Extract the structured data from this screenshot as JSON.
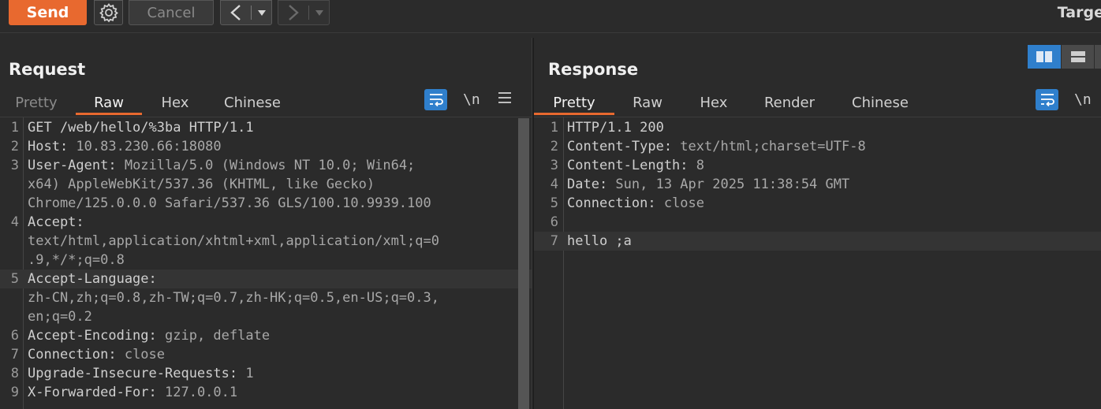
{
  "toolbar": {
    "send_label": "Send",
    "cancel_label": "Cancel",
    "target_label": "Targe",
    "back_icon": "chevron-left-icon",
    "forward_icon": "chevron-right-icon",
    "gear_icon": "gear-icon"
  },
  "colors": {
    "accent": "#e8692f",
    "toggle_active": "#2f7fcc",
    "background": "#2b2b2b"
  },
  "request": {
    "title": "Request",
    "tabs": [
      {
        "label": "Pretty",
        "state": "dim"
      },
      {
        "label": "Raw",
        "state": "active"
      },
      {
        "label": "Hex",
        "state": "normal"
      },
      {
        "label": "Chinese",
        "state": "normal"
      }
    ],
    "newline_label": "\\n",
    "lines": [
      {
        "n": "1",
        "key": "GET /web/hello/%3ba HTTP/1.1",
        "val": ""
      },
      {
        "n": "2",
        "key": "Host: ",
        "val": "10.83.230.66:18080"
      },
      {
        "n": "3",
        "key": "User-Agent: ",
        "val": "Mozilla/5.0 (Windows NT 10.0; Win64;"
      },
      {
        "n": "",
        "key": "",
        "val": "x64) AppleWebKit/537.36 (KHTML, like Gecko)"
      },
      {
        "n": "",
        "key": "",
        "val": "Chrome/125.0.0.0 Safari/537.36 GLS/100.10.9939.100"
      },
      {
        "n": "4",
        "key": "Accept:",
        "val": ""
      },
      {
        "n": "",
        "key": "",
        "val": "text/html,application/xhtml+xml,application/xml;q=0"
      },
      {
        "n": "",
        "key": "",
        "val": ".9,*/*;q=0.8"
      },
      {
        "n": "5",
        "key": "Accept-Language:",
        "val": "",
        "hl": true
      },
      {
        "n": "",
        "key": "",
        "val": "zh-CN,zh;q=0.8,zh-TW;q=0.7,zh-HK;q=0.5,en-US;q=0.3,"
      },
      {
        "n": "",
        "key": "",
        "val": "en;q=0.2"
      },
      {
        "n": "6",
        "key": "Accept-Encoding: ",
        "val": "gzip, deflate"
      },
      {
        "n": "7",
        "key": "Connection: ",
        "val": "close"
      },
      {
        "n": "8",
        "key": "Upgrade-Insecure-Requests: ",
        "val": "1"
      },
      {
        "n": "9",
        "key": "X-Forwarded-For: ",
        "val": "127.0.0.1"
      }
    ]
  },
  "response": {
    "title": "Response",
    "tabs": [
      {
        "label": "Pretty",
        "state": "active"
      },
      {
        "label": "Raw",
        "state": "normal"
      },
      {
        "label": "Hex",
        "state": "normal"
      },
      {
        "label": "Render",
        "state": "normal"
      },
      {
        "label": "Chinese",
        "state": "normal"
      }
    ],
    "newline_label": "\\n",
    "lines": [
      {
        "n": "1",
        "key": "HTTP/1.1 200",
        "val": ""
      },
      {
        "n": "2",
        "key": "Content-Type: ",
        "val": "text/html;charset=UTF-8"
      },
      {
        "n": "3",
        "key": "Content-Length: ",
        "val": "8"
      },
      {
        "n": "4",
        "key": "Date: ",
        "val": "Sun, 13 Apr 2025 11:38:54 GMT"
      },
      {
        "n": "5",
        "key": "Connection: ",
        "val": "close"
      },
      {
        "n": "6",
        "key": "",
        "val": ""
      },
      {
        "n": "7",
        "key": "hello ;a",
        "val": "",
        "hl": true
      }
    ]
  }
}
